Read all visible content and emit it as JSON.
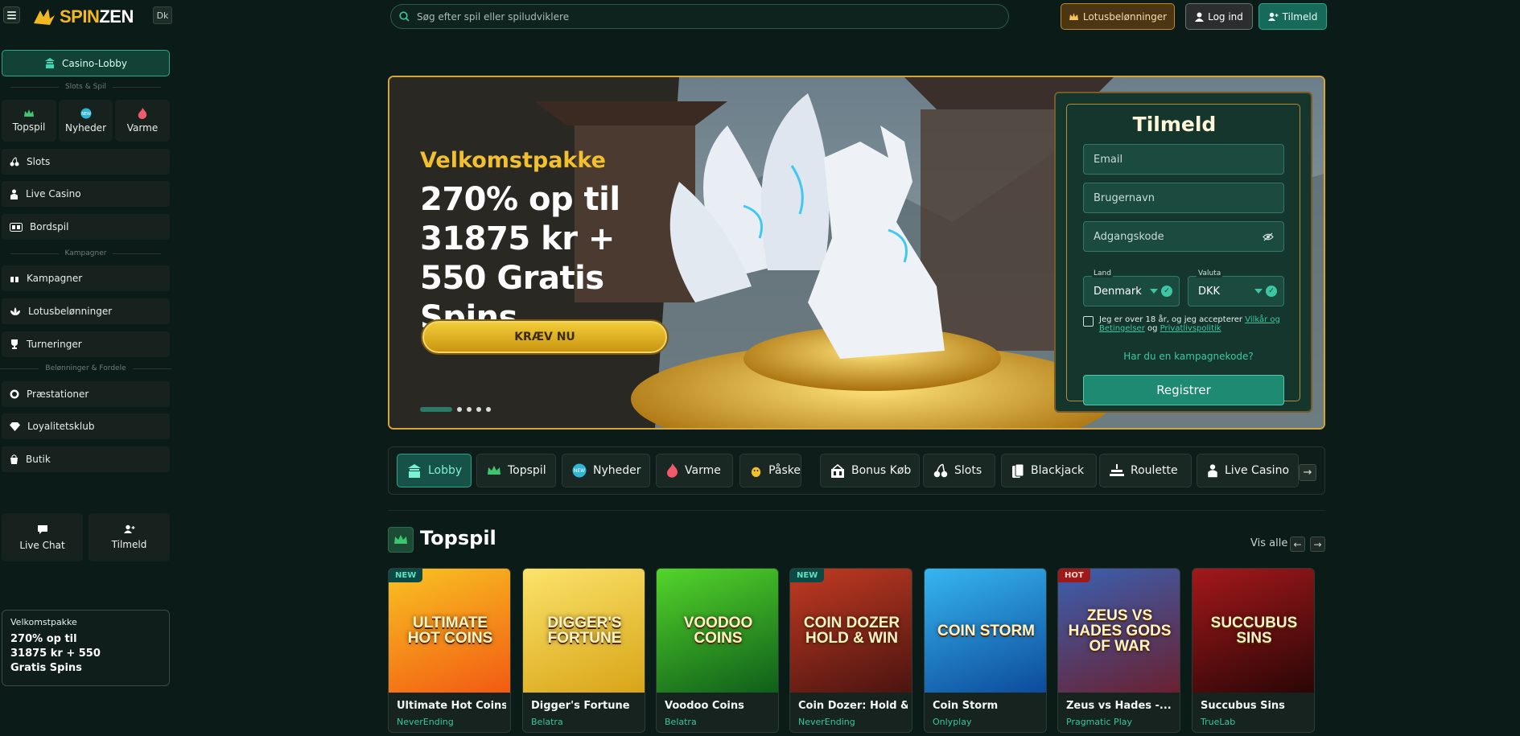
{
  "header": {
    "menu_icon": "hamburger-icon",
    "logo": {
      "part1": "SPIN",
      "part2": "ZEN"
    },
    "lang": "Dk",
    "search_placeholder": "Søg efter spil eller spiludviklere",
    "lotus_label": "Lotusbelønninger",
    "login_label": "Log ind",
    "signup_label": "Tilmeld"
  },
  "sidebar": {
    "casino_lobby": "Casino-Lobby",
    "slots_section": "Slots & Spil",
    "tiles": [
      {
        "label": "Topspil",
        "icon": "crown-icon"
      },
      {
        "label": "Nyheder",
        "icon": "new-badge-icon"
      },
      {
        "label": "Varme",
        "icon": "flame-icon"
      }
    ],
    "games_items": [
      {
        "label": "Slots",
        "icon": "cherries-icon"
      },
      {
        "label": "Live Casino",
        "icon": "dealer-icon"
      },
      {
        "label": "Bordspil",
        "icon": "table-icon"
      }
    ],
    "campaigns_section": "Kampagner",
    "campaign_items": [
      {
        "label": "Kampagner",
        "icon": "gift-icon"
      },
      {
        "label": "Lotusbelønninger",
        "icon": "lotus-icon"
      },
      {
        "label": "Turneringer",
        "icon": "trophy-icon"
      }
    ],
    "rewards_section": "Belønninger & Fordele",
    "reward_items": [
      {
        "label": "Præstationer",
        "icon": "medal-icon"
      },
      {
        "label": "Loyalitetsklub",
        "icon": "diamond-icon"
      },
      {
        "label": "Butik",
        "icon": "shop-bag-icon"
      }
    ],
    "live_chat": "Live Chat",
    "signup": "Tilmeld",
    "promo": {
      "title": "Velkomstpakke",
      "body": "270% op til 31875 kr + 550 Gratis Spins"
    }
  },
  "hero": {
    "kicker": "Velkomstpakke",
    "title": "270% op til 31875 kr + 550 Gratis Spins",
    "cta": "KRÆV NU",
    "slides_total": 5,
    "slide_active": 1
  },
  "signup_form": {
    "title": "Tilmeld",
    "email_placeholder": "Email",
    "username_placeholder": "Brugernavn",
    "password_placeholder": "Adgangskode",
    "country_label": "Land",
    "country_value": "Denmark",
    "currency_label": "Valuta",
    "currency_value": "DKK",
    "terms_prefix": "Jeg er over 18 år, og jeg accepterer",
    "terms_link": "Vilkår og Betingelser",
    "terms_and": "og",
    "privacy_link": "Privatlivspolitik",
    "promo_question": "Har du en kampagnekode?",
    "register": "Registrer"
  },
  "categories": [
    {
      "label": "Lobby",
      "icon": "pagoda-icon",
      "active": true
    },
    {
      "label": "Topspil",
      "icon": "crown-icon"
    },
    {
      "label": "Nyheder",
      "icon": "new-badge-icon"
    },
    {
      "label": "Varme",
      "icon": "flame-icon"
    },
    {
      "label": "Påske",
      "icon": "easter-chick-icon"
    },
    {
      "label": "Bonus Køb",
      "icon": "bonus-buy-icon"
    },
    {
      "label": "Slots",
      "icon": "cherries-icon"
    },
    {
      "label": "Blackjack",
      "icon": "cards-icon"
    },
    {
      "label": "Roulette",
      "icon": "roulette-icon"
    },
    {
      "label": "Live Casino",
      "icon": "dealer-icon"
    }
  ],
  "topspil": {
    "title": "Topspil",
    "view_all": "Vis alle",
    "games": [
      {
        "name": "Ultimate Hot Coins:...",
        "provider": "NeverEnding",
        "badge": "NEW",
        "art": "ULTIMATE HOT COINS",
        "colors": [
          "#f25a12",
          "#f8c222"
        ]
      },
      {
        "name": "Digger's Fortune",
        "provider": "Belatra",
        "badge": "",
        "art": "DIGGER'S FORTUNE",
        "colors": [
          "#d8a417",
          "#fbe36a"
        ]
      },
      {
        "name": "Voodoo Coins",
        "provider": "Belatra",
        "badge": "",
        "art": "VOODOO COINS",
        "colors": [
          "#0e5e1a",
          "#53d52a"
        ]
      },
      {
        "name": "Coin Dozer: Hold &...",
        "provider": "NeverEnding",
        "badge": "NEW",
        "art": "COIN DOZER HOLD & WIN",
        "colors": [
          "#4a1410",
          "#c23a22"
        ]
      },
      {
        "name": "Coin Storm",
        "provider": "Onlyplay",
        "badge": "",
        "art": "COIN STORM",
        "colors": [
          "#0c4a9a",
          "#36b6f0"
        ]
      },
      {
        "name": "Zeus vs Hades -...",
        "provider": "Pragmatic Play",
        "badge": "HOT",
        "art": "ZEUS VS HADES GODS OF WAR",
        "colors": [
          "#6a2030",
          "#3a60b0"
        ]
      },
      {
        "name": "Succubus Sins",
        "provider": "TrueLab",
        "badge": "",
        "art": "SUCCUBUS SINS",
        "colors": [
          "#2a0606",
          "#a3181b"
        ]
      }
    ]
  },
  "colors": {
    "accent": "#2fa48a",
    "gold": "#f2c02e",
    "background": "#0b1b17"
  }
}
